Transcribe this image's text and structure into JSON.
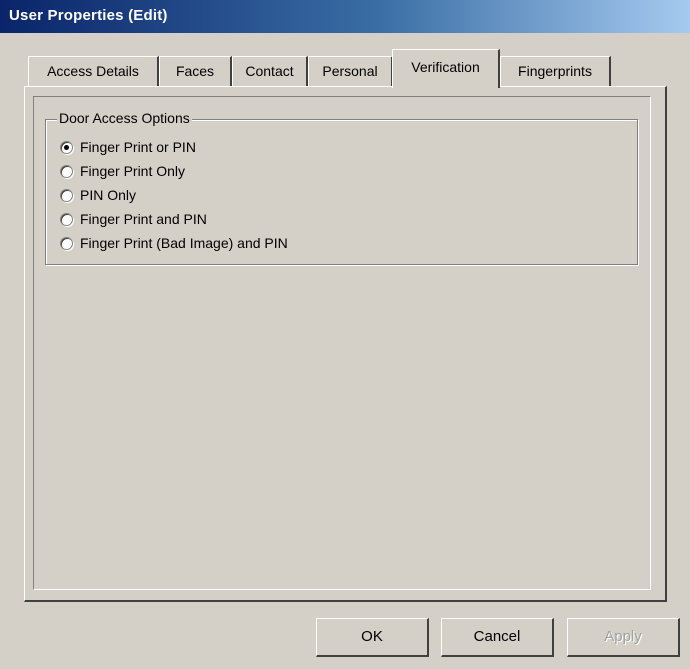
{
  "window": {
    "title": "User Properties (Edit)"
  },
  "tabs": [
    {
      "label": "Access Details"
    },
    {
      "label": "Faces"
    },
    {
      "label": "Contact"
    },
    {
      "label": "Personal"
    },
    {
      "label": "Verification",
      "active": true
    },
    {
      "label": "Fingerprints"
    }
  ],
  "door_access": {
    "legend": "Door Access Options",
    "selected": "Finger Print or PIN",
    "options": [
      {
        "label": "Finger Print or PIN",
        "checked": true
      },
      {
        "label": "Finger Print Only",
        "checked": false
      },
      {
        "label": "PIN Only",
        "checked": false
      },
      {
        "label": "Finger Print and PIN",
        "checked": false
      },
      {
        "label": "Finger Print (Bad Image) and PIN",
        "checked": false
      }
    ]
  },
  "buttons": {
    "ok": "OK",
    "cancel": "Cancel",
    "apply": "Apply",
    "apply_enabled": false
  }
}
